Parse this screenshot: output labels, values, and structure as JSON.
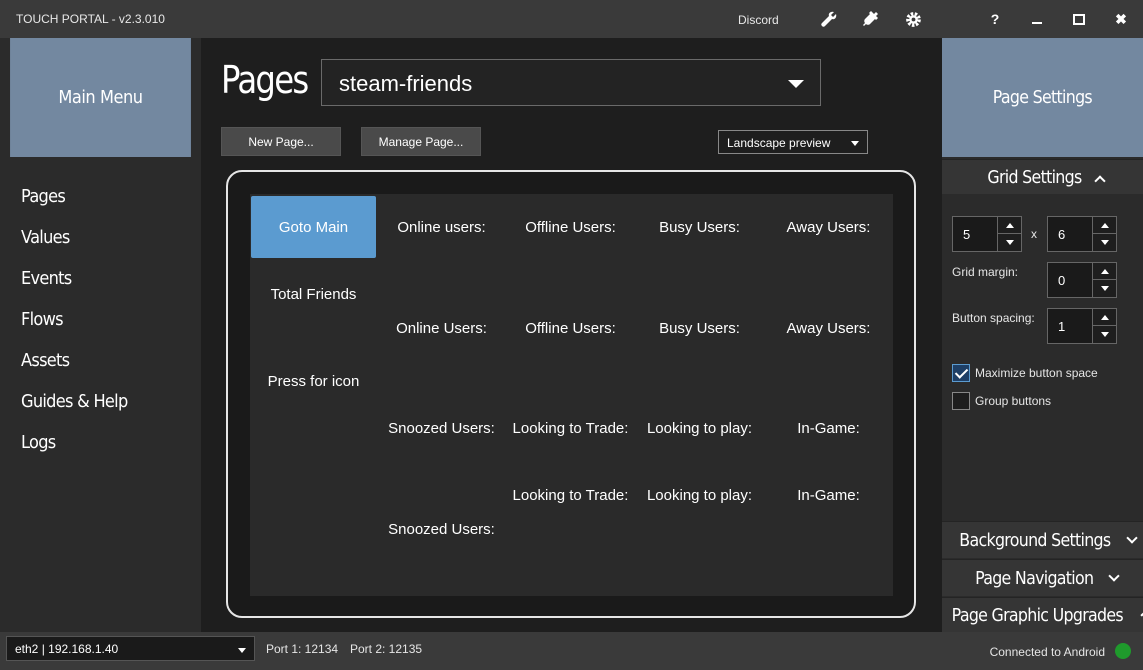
{
  "app": {
    "title": "TOUCH PORTAL - v2.3.010",
    "discord_label": "Discord"
  },
  "titlebar_icons": [
    "wrench-icon",
    "plug-icon",
    "gear-icon"
  ],
  "window_controls": {
    "help": "?",
    "minimize": "–",
    "maximize": "☐",
    "close": "✖"
  },
  "left": {
    "header": "Main Menu",
    "nav": [
      "Pages",
      "Values",
      "Events",
      "Flows",
      "Assets",
      "Guides & Help",
      "Logs"
    ]
  },
  "center": {
    "title": "Pages",
    "page_select": "steam-friends",
    "new_page": "New Page...",
    "manage_page": "Manage Page...",
    "preview_mode": "Landscape preview",
    "buttons": [
      "Goto Main",
      "Online users:",
      "Offline Users:",
      "Busy Users:",
      "Away Users:",
      "Total Friends",
      "Online Users:",
      "Offline Users:",
      "Busy Users:",
      "Away Users:",
      "Press for icon",
      "Snoozed Users:",
      "Looking to Trade:",
      "Looking to play:",
      "In-Game:",
      "Looking to Trade:",
      "Looking to play:",
      "In-Game:",
      "Snoozed Users:"
    ]
  },
  "right": {
    "header": "Page Settings",
    "grid_settings": "Grid Settings",
    "columns": "5",
    "times": "x",
    "rows": "6",
    "grid_margin_label": "Grid margin:",
    "grid_margin": "0",
    "button_spacing_label": "Button spacing:",
    "button_spacing": "1",
    "maximize_label": "Maximize button space",
    "maximize_checked": true,
    "group_label": "Group buttons",
    "group_checked": false,
    "background_settings": "Background Settings",
    "page_navigation": "Page Navigation",
    "page_graphic_upgrades": "Page Graphic Upgrades"
  },
  "status": {
    "network": "eth2 | 192.168.1.40",
    "port1": "Port 1: 12134",
    "port2": "Port 2: 12135",
    "connection": "Connected to Android",
    "connection_color": "#1f9a2c"
  },
  "colors": {
    "accent": "#7388a0",
    "button_blue": "#5b9bd0"
  }
}
